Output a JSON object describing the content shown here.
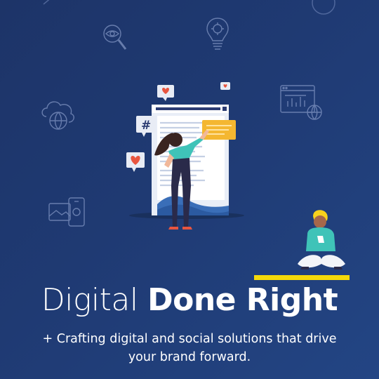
{
  "headline": {
    "light": "Digital",
    "bold": "Done Right"
  },
  "tagline": "+ Crafting digital and social solutions that drive your brand forward.",
  "colors": {
    "background_start": "#1d3468",
    "background_end": "#234584",
    "highlight": "#f5d90a",
    "card_accent": "#f4b731",
    "heart": "#e8553f",
    "shirt": "#3fc3b8"
  },
  "icons": [
    "eye-magnifier-icon",
    "lightbulb-gear-icon",
    "cloud-globe-icon",
    "browser-chart-globe-icon",
    "mobile-photo-icon",
    "circle-icon",
    "pen-icon"
  ]
}
